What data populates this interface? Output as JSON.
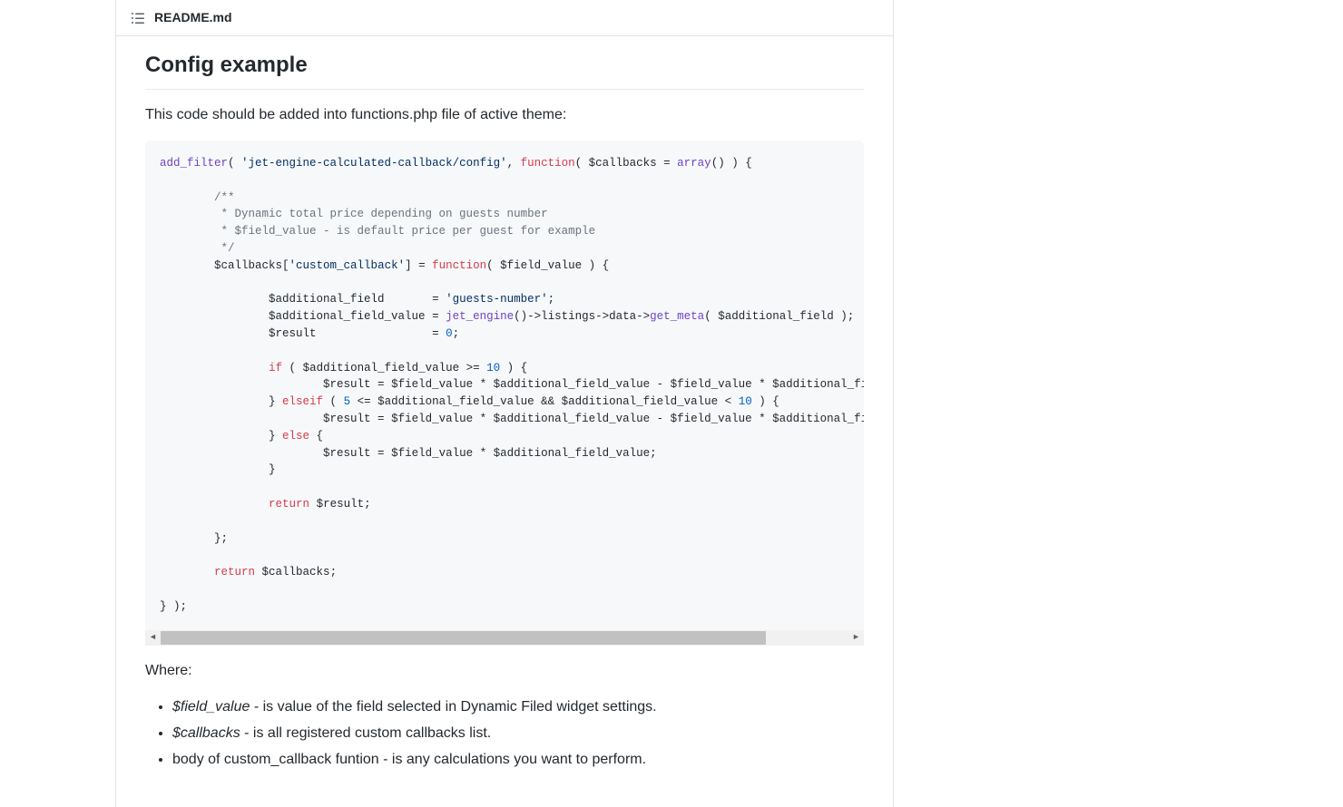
{
  "header": {
    "filename": "README.md"
  },
  "doc": {
    "heading": "Config example",
    "intro": "This code should be added into functions.php file of active theme:",
    "where_label": "Where:",
    "bullets": {
      "b1_var": "$field_value",
      "b1_text": " - is value of the field selected in Dynamic Filed widget settings.",
      "b2_var": "$callbacks",
      "b2_text": " - is all registered custom callbacks list.",
      "b3_text": "body of custom_callback funtion - is any calculations you want to perform."
    }
  },
  "code": {
    "l1a": "add_filter",
    "l1b": "( ",
    "l1c": "'jet-engine-calculated-callback/config'",
    "l1d": ", ",
    "l1e": "function",
    "l1f": "( ",
    "l1g": "$callbacks",
    "l1h": " = ",
    "l1i": "array",
    "l1j": "() ) {",
    "c1": "        /**",
    "c2": "         * Dynamic total price depending on guests number",
    "c3": "         * $field_value - is default price per guest for example",
    "c4": "         */",
    "l2a": "        ",
    "l2b": "$callbacks",
    "l2c": "[",
    "l2d": "'custom_callback'",
    "l2e": "] = ",
    "l2f": "function",
    "l2g": "( ",
    "l2h": "$field_value",
    "l2i": " ) {",
    "l3a": "                ",
    "l3b": "$additional_field",
    "l3c": "       = ",
    "l3d": "'guests-number'",
    "l3e": ";",
    "l4a": "                ",
    "l4b": "$additional_field_value",
    "l4c": " = ",
    "l4d": "jet_engine",
    "l4e": "()->",
    "l4f": "listings",
    "l4g": "->",
    "l4h": "data",
    "l4i": "->",
    "l4j": "get_meta",
    "l4k": "( ",
    "l4l": "$additional_field",
    "l4m": " );",
    "l5a": "                ",
    "l5b": "$result",
    "l5c": "                 = ",
    "l5d": "0",
    "l5e": ";",
    "l6a": "                ",
    "l6b": "if",
    "l6c": " ( ",
    "l6d": "$additional_field_value",
    "l6e": " >= ",
    "l6f": "10",
    "l6g": " ) {",
    "l7a": "                        ",
    "l7b": "$result",
    "l7c": " = ",
    "l7d": "$field_value",
    "l7e": " * ",
    "l7f": "$additional_field_value",
    "l7g": " - ",
    "l7h": "$field_value",
    "l7i": " * ",
    "l7j": "$additional_field_v",
    "l8a": "                } ",
    "l8b": "elseif",
    "l8c": " ( ",
    "l8d": "5",
    "l8e": " <= ",
    "l8f": "$additional_field_value",
    "l8g": " && ",
    "l8h": "$additional_field_value",
    "l8i": " < ",
    "l8j": "10",
    "l8k": " ) {",
    "l9a": "                        ",
    "l9b": "$result",
    "l9c": " = ",
    "l9d": "$field_value",
    "l9e": " * ",
    "l9f": "$additional_field_value",
    "l9g": " - ",
    "l9h": "$field_value",
    "l9i": " * ",
    "l9j": "$additional_field_v",
    "l10a": "                } ",
    "l10b": "else",
    "l10c": " {",
    "l11a": "                        ",
    "l11b": "$result",
    "l11c": " = ",
    "l11d": "$field_value",
    "l11e": " * ",
    "l11f": "$additional_field_value",
    "l11g": ";",
    "l12": "                }",
    "l13a": "                ",
    "l13b": "return",
    "l13c": " ",
    "l13d": "$result",
    "l13e": ";",
    "l14": "        };",
    "l15a": "        ",
    "l15b": "return",
    "l15c": " ",
    "l15d": "$callbacks",
    "l15e": ";",
    "l16": "} );"
  }
}
